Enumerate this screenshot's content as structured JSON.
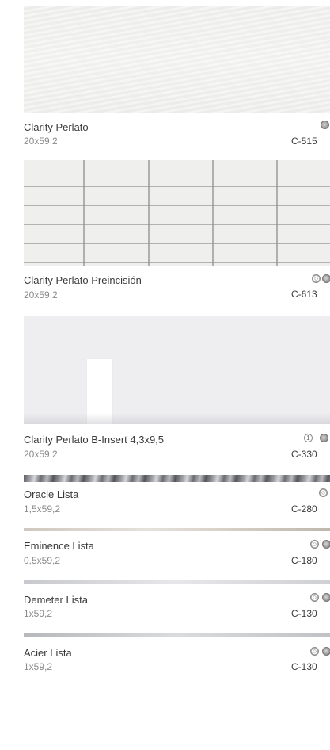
{
  "products": [
    {
      "name": "Clarity Perlato",
      "size": "20x59,2",
      "code": "C-515",
      "icons": [
        "dark-circle-icon"
      ]
    },
    {
      "name": "Clarity Perlato Preincisión",
      "size": "20x59,2",
      "code": "C-613",
      "icons": [
        "flower-icon",
        "dark-circle-icon"
      ]
    },
    {
      "name": "Clarity Perlato B-Insert  4,3x9,5",
      "size": "20x59,2",
      "code": "C-330",
      "icons": [
        "info-icon",
        "dark-circle-icon"
      ],
      "info_glyph": "1"
    },
    {
      "name": "Oracle Lista",
      "size": "1,5x59,2",
      "code": "C-280",
      "icons": [
        "flower-icon"
      ]
    },
    {
      "name": "Eminence Lista",
      "size": "0,5x59,2",
      "code": "C-180",
      "icons": [
        "flower-icon",
        "dark-circle-icon"
      ]
    },
    {
      "name": "Demeter Lista",
      "size": "1x59,2",
      "code": "C-130",
      "icons": [
        "flower-icon",
        "dark-circle-icon"
      ]
    },
    {
      "name": "Acier Lista",
      "size": "1x59,2",
      "code": "C-130",
      "icons": [
        "flower-icon",
        "dark-circle-icon"
      ]
    }
  ],
  "colors": {
    "text": "#3a3a3a",
    "muted": "#8a8a8a",
    "tile": "#f0f0ee",
    "grout": "#8d8d8d"
  }
}
